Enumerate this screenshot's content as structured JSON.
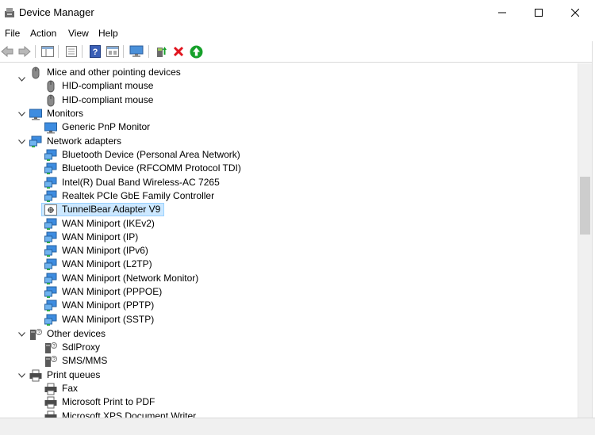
{
  "window": {
    "title": "Device Manager"
  },
  "menu": [
    "File",
    "Action",
    "View",
    "Help"
  ],
  "toolbar_icons": [
    "back-arrow-icon",
    "forward-arrow-icon",
    "show-hide-tree-icon",
    "properties-icon",
    "help-icon",
    "device-view-icon",
    "monitor-scan-icon",
    "update-driver-icon",
    "uninstall-device-icon",
    "enable-device-icon"
  ],
  "tree": {
    "mice": {
      "label": "Mice and other pointing devices",
      "items": [
        "HID-compliant mouse",
        "HID-compliant mouse"
      ]
    },
    "monitors": {
      "label": "Monitors",
      "items": [
        "Generic PnP Monitor"
      ]
    },
    "network": {
      "label": "Network adapters",
      "items": [
        "Bluetooth Device (Personal Area Network)",
        "Bluetooth Device (RFCOMM Protocol TDI)",
        "Intel(R) Dual Band Wireless-AC 7265",
        "Realtek PCIe GbE Family Controller",
        "TunnelBear Adapter V9",
        "WAN Miniport (IKEv2)",
        "WAN Miniport (IP)",
        "WAN Miniport (IPv6)",
        "WAN Miniport (L2TP)",
        "WAN Miniport (Network Monitor)",
        "WAN Miniport (PPPOE)",
        "WAN Miniport (PPTP)",
        "WAN Miniport (SSTP)"
      ],
      "selected_index": 4
    },
    "other": {
      "label": "Other devices",
      "items": [
        "SdlProxy",
        "SMS/MMS"
      ]
    },
    "print": {
      "label": "Print queues",
      "items": [
        "Fax",
        "Microsoft Print to PDF",
        "Microsoft XPS Document Writer"
      ]
    }
  },
  "colors": {
    "selection": "#cce8ff",
    "selection_border": "#99d1ff",
    "enable_green": "#16a02a",
    "uninstall_red": "#e0141e"
  }
}
